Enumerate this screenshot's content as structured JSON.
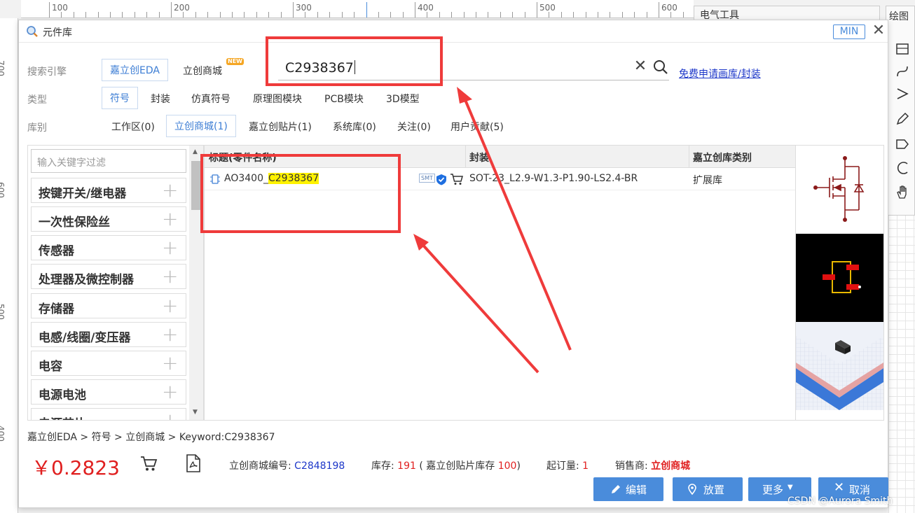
{
  "canvas": {
    "ruler_top_labels": [
      "100",
      "200",
      "300",
      "400",
      "500",
      "600"
    ],
    "ruler_left_labels": [
      "700",
      "600",
      "500",
      "400"
    ],
    "tool_panel_title": "电气工具",
    "draw_panel_title": "绘图"
  },
  "dialog": {
    "title": "元件库",
    "min_label": "MIN",
    "close_label": "✕"
  },
  "search": {
    "engine_label": "搜索引擎",
    "engines": [
      "嘉立创EDA",
      "立创商城"
    ],
    "new_badge": "NEW",
    "query": "C2938367",
    "clear_label": "✕",
    "free_link": "免费申请画库/封装"
  },
  "filters": {
    "type_label": "类型",
    "types": [
      "符号",
      "封装",
      "仿真符号",
      "原理图模块",
      "PCB模块",
      "3D模型"
    ],
    "lib_label": "库别",
    "libs": [
      "工作区(0)",
      "立创商城(1)",
      "嘉立创贴片(1)",
      "系统库(0)",
      "关注(0)",
      "用户贡献(5)"
    ]
  },
  "categories": {
    "filter_placeholder": "输入关键字过滤",
    "items": [
      "按键开关/继电器",
      "一次性保险丝",
      "传感器",
      "处理器及微控制器",
      "存储器",
      "电感/线圈/变压器",
      "电容",
      "电源电池",
      "电源芯片"
    ]
  },
  "table": {
    "headers": [
      "标题(零件名称)",
      "封装",
      "嘉立创库类别"
    ],
    "rows": [
      {
        "title_prefix": "AO3400_",
        "title_highlight": "C2938367",
        "smt": "SMT",
        "package": "SOT-23_L2.9-W1.3-P1.90-LS2.4-BR",
        "category": "扩展库"
      }
    ]
  },
  "footer": {
    "breadcrumb": "嘉立创EDA > 符号 > 立创商城 > Keyword:C2938367",
    "price": "￥0.2823",
    "lcsc_label": "立创商城编号: ",
    "lcsc_value": "C2848198",
    "stock_label": "库存: ",
    "stock_value": "191",
    "stock_paren_open": " ( 嘉立创贴片库存 ",
    "stock_smt_value": "100",
    "stock_paren_close": ")",
    "moq_label": "起订量: ",
    "moq_value": "1",
    "seller_label": "销售商: ",
    "seller_value": "立创商城"
  },
  "actions": {
    "edit": "编辑",
    "place": "放置",
    "more": "更多",
    "cancel": "取消"
  },
  "colors": {
    "accent": "#4a8cdb",
    "annotation": "#ef3b3b",
    "highlight": "#fff200",
    "price": "#e01f1f"
  },
  "watermark": "CSDN @Aurora Smith"
}
